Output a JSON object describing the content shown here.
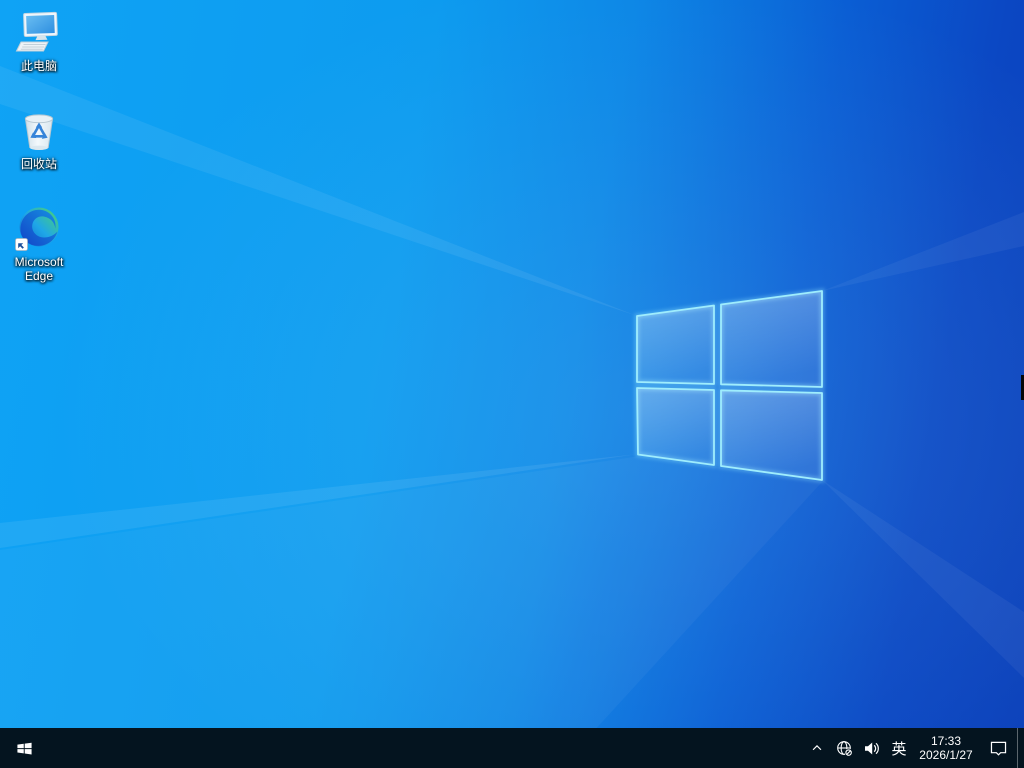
{
  "colors": {
    "wallpaper_left": "#0FA3F5",
    "wallpaper_right": "#0C41BA",
    "taskbar_background": "#04141F",
    "logo_pane_edge": "#9FEDFD",
    "icon_label": "#FFFFFF"
  },
  "wallpaper": {
    "description_icon": "windows-flag-logo-icon"
  },
  "desktop": {
    "icons": [
      {
        "label": "此电脑",
        "icon": "computer-monitor-icon"
      },
      {
        "label": "回收站",
        "icon": "recycle-bin-icon"
      },
      {
        "label": "Microsoft Edge",
        "icon": "edge-swirl-icon",
        "badge": "shortcut-arrow-icon"
      }
    ]
  },
  "taskbar": {
    "start_icon": "windows-logo-icon",
    "tray": {
      "hidden_icons_icon": "chevron-up-icon",
      "network_icon": "globe-no-internet-icon",
      "volume_icon": "speaker-icon",
      "language_indicator": "英",
      "time": "17:33",
      "date": "2026/1/27",
      "action_center_icon": "notification-bubble-icon"
    }
  }
}
